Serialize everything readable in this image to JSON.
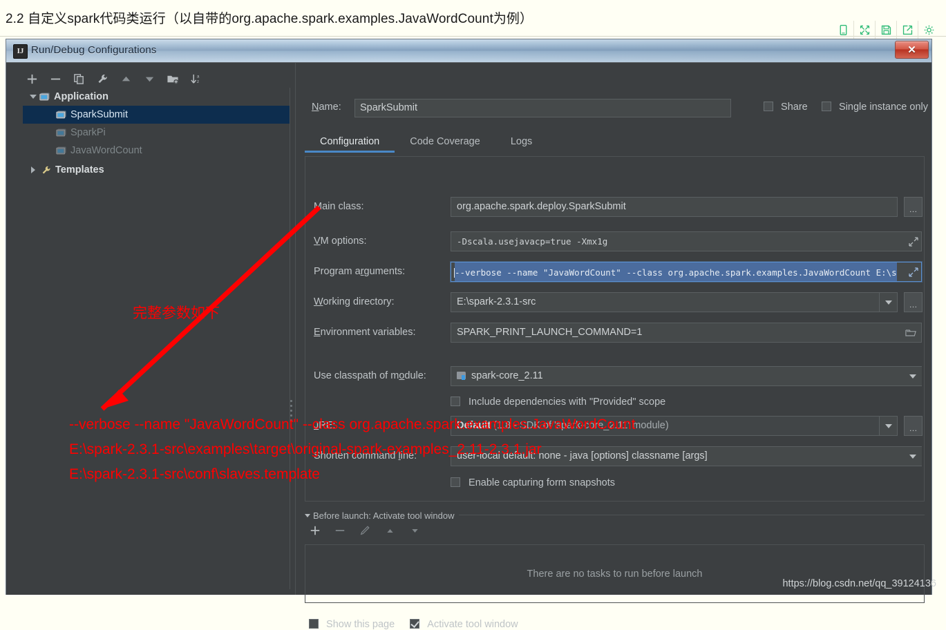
{
  "article": {
    "heading": "2.2 自定义spark代码类运行（以自带的org.apache.spark.examples.JavaWordCount为例）",
    "toolbar_icons": [
      "mobile-icon",
      "expand-icon",
      "save-icon",
      "share-icon",
      "gear-icon"
    ]
  },
  "window": {
    "title": "Run/Debug Configurations",
    "app_icon_text": "IJ",
    "close_label": "✕"
  },
  "left_panel": {
    "toolbar": [
      {
        "name": "add-button",
        "glyph": "+"
      },
      {
        "name": "remove-button",
        "glyph": "−"
      },
      {
        "name": "copy-button",
        "glyph": "copy-icon"
      },
      {
        "name": "edit-templates-button",
        "glyph": "wrench-icon"
      },
      {
        "name": "move-up-button",
        "glyph": "▲"
      },
      {
        "name": "move-down-button",
        "glyph": "▼"
      },
      {
        "name": "new-folder-button",
        "glyph": "folder-plus-icon"
      },
      {
        "name": "sort-button",
        "glyph": "sort-az-icon"
      }
    ],
    "tree": [
      {
        "label": "Application",
        "style": "bold",
        "expanded": true,
        "indent": 0,
        "icon": "application-icon"
      },
      {
        "label": "SparkSubmit",
        "style": "selected",
        "indent": 1,
        "icon": "run-config-icon"
      },
      {
        "label": "SparkPi",
        "style": "dim",
        "indent": 1,
        "icon": "run-config-icon"
      },
      {
        "label": "JavaWordCount",
        "style": "dim",
        "indent": 1,
        "icon": "run-config-icon"
      },
      {
        "label": "Templates",
        "style": "bold",
        "expanded": false,
        "indent": 0,
        "icon": "wrench-icon"
      }
    ]
  },
  "right_panel": {
    "name_label": "Name:",
    "name_value": "SparkSubmit",
    "share_label": "Share",
    "share_checked": false,
    "single_instance_label": "Single instance only",
    "single_instance_checked": false,
    "tabs": [
      {
        "label": "Configuration",
        "active": true
      },
      {
        "label": "Code Coverage",
        "active": false
      },
      {
        "label": "Logs",
        "active": false
      }
    ],
    "fields": {
      "main_class_label": "Main class:",
      "main_class_value": "org.apache.spark.deploy.SparkSubmit",
      "vm_options_label": "VM options:",
      "vm_options_value": "-Dscala.usejavacp=true -Xmx1g",
      "program_arguments_label": "Program arguments:",
      "program_arguments_value": "--verbose --name \"JavaWordCount\"  --class org.apache.spark.examples.JavaWordCount  E:\\s",
      "working_directory_label": "Working directory:",
      "working_directory_value": "E:\\spark-2.3.1-src",
      "environment_variables_label": "Environment variables:",
      "environment_variables_value": "SPARK_PRINT_LAUNCH_COMMAND=1",
      "use_classpath_label": "Use classpath of module:",
      "use_classpath_value": "spark-core_2.11",
      "include_deps_label": "Include dependencies with \"Provided\" scope",
      "include_deps_checked": false,
      "jre_label": "JRE:",
      "jre_value_bold": "Default",
      "jre_value_rest": " (1.8 - SDK of 'spark-core_2.11' module)",
      "shorten_label": "Shorten command line:",
      "shorten_value": "user-local default: none - java [options] classname [args]",
      "enable_capture_label": "Enable capturing form snapshots",
      "enable_capture_checked": false
    },
    "before_launch": {
      "title": "Before launch: Activate tool window",
      "toolbar": [
        {
          "name": "before-launch-add-button",
          "glyph": "+"
        },
        {
          "name": "before-launch-remove-button",
          "glyph": "−"
        },
        {
          "name": "before-launch-edit-button",
          "glyph": "pencil-icon"
        },
        {
          "name": "before-launch-up-button",
          "glyph": "▲"
        },
        {
          "name": "before-launch-down-button",
          "glyph": "▼"
        }
      ],
      "empty_text": "There are no tasks to run before launch"
    },
    "footer": {
      "show_page_label": "Show this page",
      "show_page_checked": false,
      "activate_tool_window_label": "Activate tool window",
      "activate_tool_window_checked": true
    }
  },
  "annotations": {
    "note_cn": "完整参数如下",
    "line1": "--verbose --name \"JavaWordCount\"  --class org.apache.spark.examples.JavaWordCount",
    "line2": "E:\\spark-2.3.1-src\\examples\\target\\original-spark-examples_2.11-2.3.1.jar",
    "line3": "E:\\spark-2.3.1-src\\conf\\slaves.template",
    "color": "#ff0000"
  },
  "watermark": "https://blog.csdn.net/qq_39124136"
}
